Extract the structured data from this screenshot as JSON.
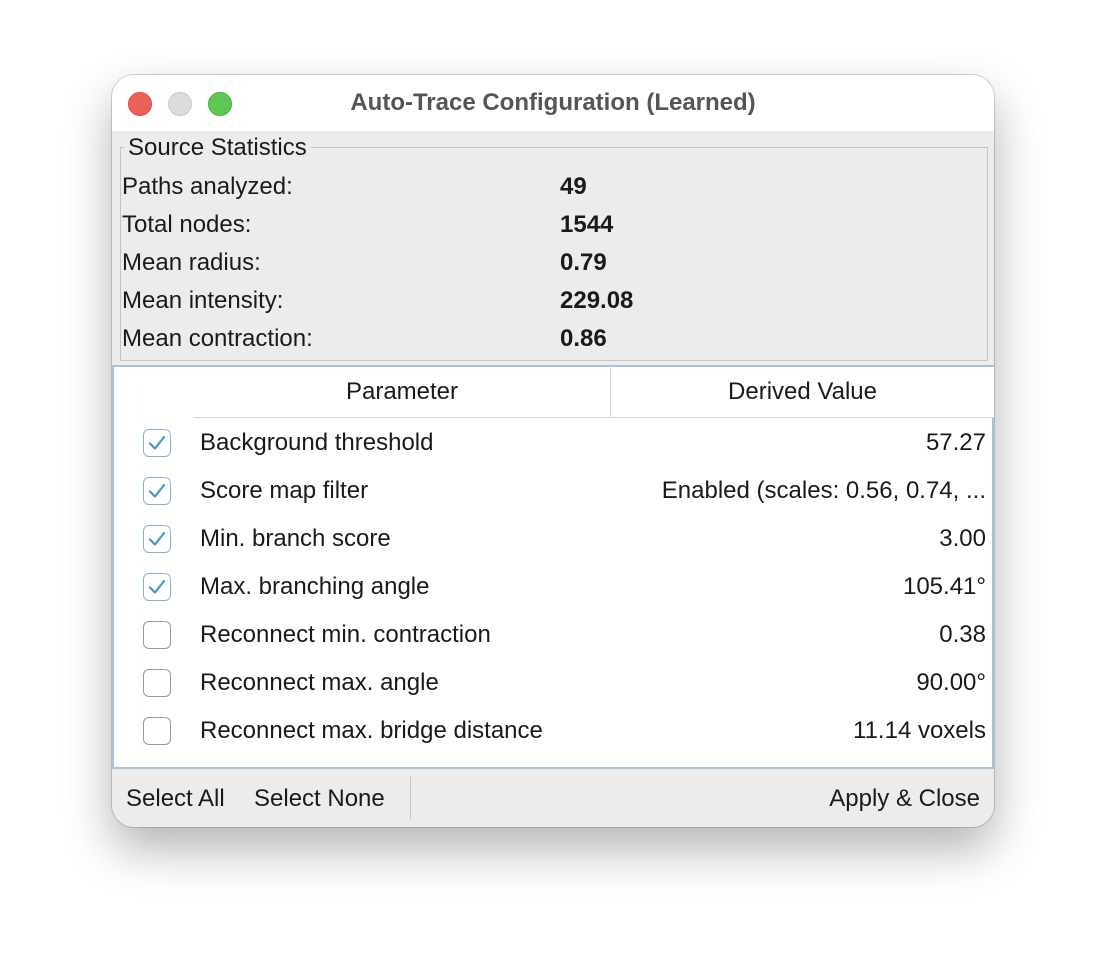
{
  "window": {
    "title": "Auto-Trace Configuration (Learned)"
  },
  "stats": {
    "legend": "Source Statistics",
    "rows": [
      {
        "label": "Paths analyzed:",
        "value": "49"
      },
      {
        "label": "Total nodes:",
        "value": "1544"
      },
      {
        "label": "Mean radius:",
        "value": "0.79"
      },
      {
        "label": "Mean intensity:",
        "value": "229.08"
      },
      {
        "label": "Mean contraction:",
        "value": "0.86"
      }
    ]
  },
  "table": {
    "header_parameter": "Parameter",
    "header_value": "Derived Value",
    "rows": [
      {
        "name": "Background threshold",
        "value": "57.27",
        "checked": true
      },
      {
        "name": "Score map filter",
        "value": "Enabled (scales: 0.56, 0.74, ...",
        "checked": true
      },
      {
        "name": "Min. branch score",
        "value": "3.00",
        "checked": true
      },
      {
        "name": "Max. branching angle",
        "value": "105.41°",
        "checked": true
      },
      {
        "name": "Reconnect min. contraction",
        "value": "0.38",
        "checked": false
      },
      {
        "name": "Reconnect max. angle",
        "value": "90.00°",
        "checked": false
      },
      {
        "name": "Reconnect max. bridge distance",
        "value": "11.14 voxels",
        "checked": false
      }
    ]
  },
  "buttons": {
    "select_all": "Select All",
    "select_none": "Select None",
    "apply_close": "Apply & Close"
  },
  "colors": {
    "checkmark": "#4f8fd6",
    "selection_border": "#a9c3dd",
    "close": "#ec5f56",
    "zoom": "#5fc553"
  }
}
